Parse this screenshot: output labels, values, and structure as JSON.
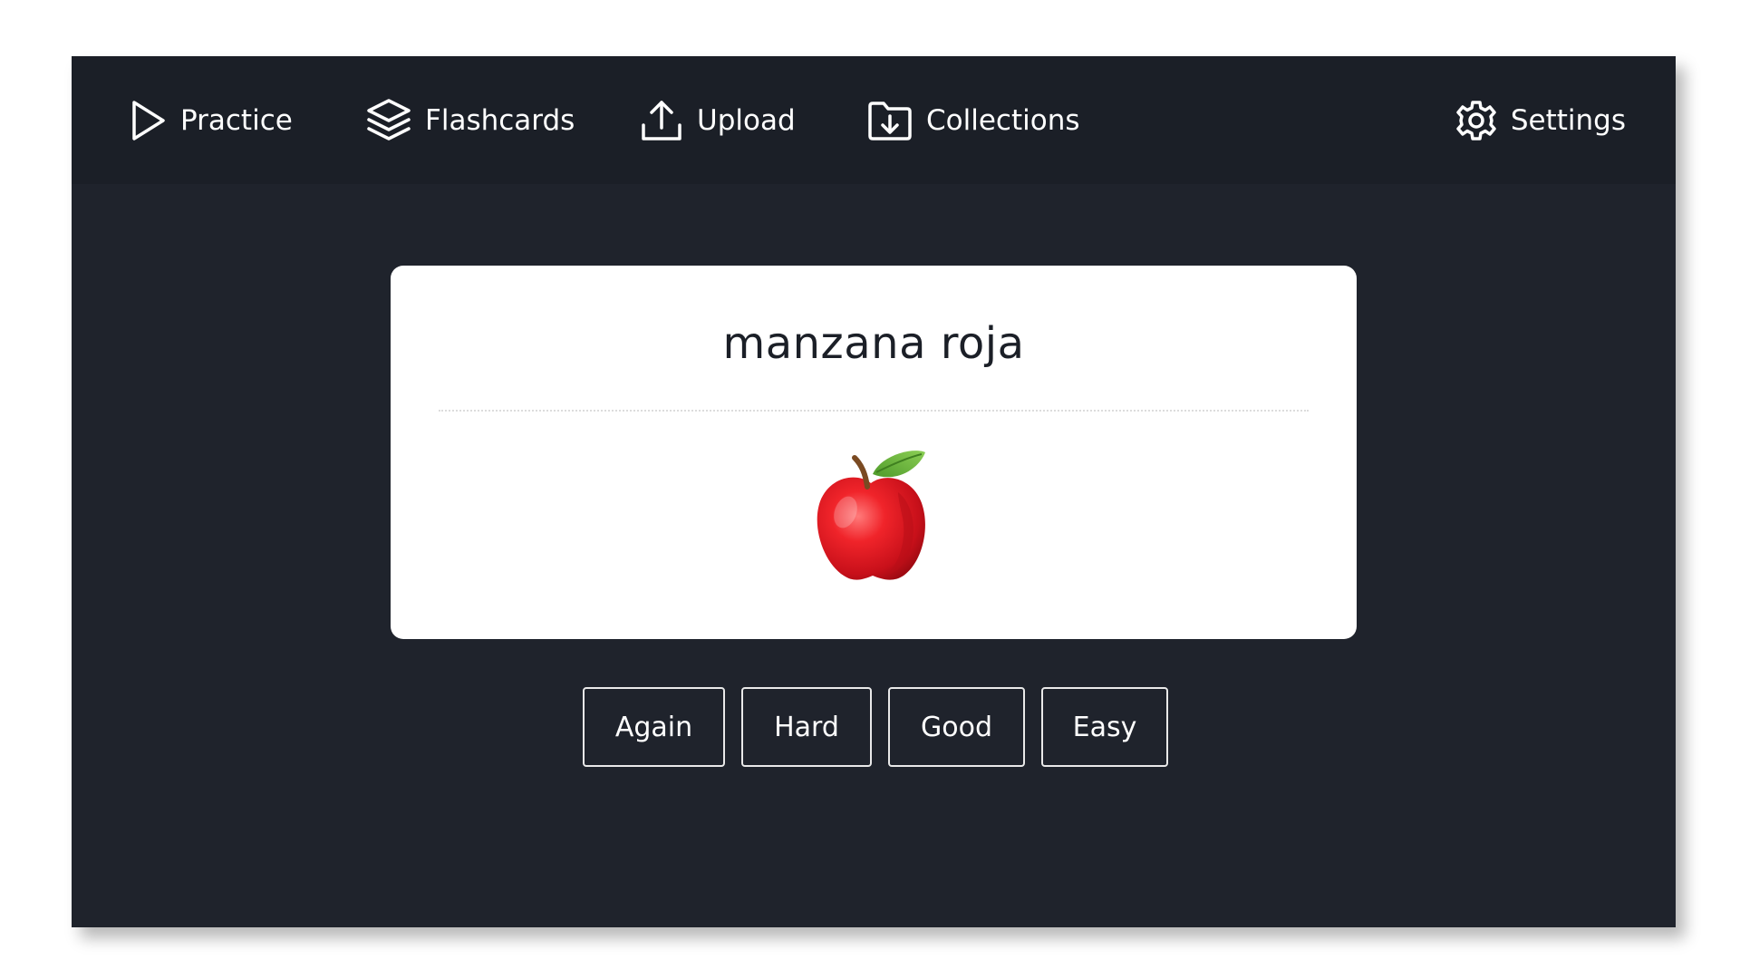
{
  "nav": {
    "practice": {
      "label": "Practice",
      "icon": "play-icon"
    },
    "flashcards": {
      "label": "Flashcards",
      "icon": "layers-icon"
    },
    "upload": {
      "label": "Upload",
      "icon": "upload-icon"
    },
    "collections": {
      "label": "Collections",
      "icon": "folder-download-icon"
    },
    "settings": {
      "label": "Settings",
      "icon": "gear-icon"
    }
  },
  "card": {
    "front": "manzana roja",
    "back_image": "red-apple-image"
  },
  "ratings": {
    "again": "Again",
    "hard": "Hard",
    "good": "Good",
    "easy": "Easy"
  },
  "colors": {
    "app_background": "#1f232c",
    "nav_background": "#1b1f27",
    "card_background": "#ffffff",
    "text_light": "#ffffff",
    "text_dark": "#1b1f27"
  }
}
